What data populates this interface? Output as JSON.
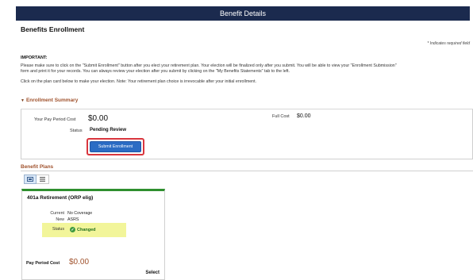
{
  "header": {
    "title": "Benefit Details"
  },
  "page": {
    "title": "Benefits Enrollment",
    "required_note": "* Indicates required field",
    "important_label": "IMPORTANT:",
    "para1_line1": "Please make sure to click on the \"Submit Enrollment\" button after you elect your retirement plan. Your election will be finalized only after you submit. You will be able to view your \"Enrollment Submission\"",
    "para1_line2": "form and print it for your records. You can always review your election after you submit by clicking on the \"My Benefits Statements\" tab to the left.",
    "para2": "Click on the plan card below to make your election. Note: Your retirement plan choice is irrevocable after your initial enrollment."
  },
  "summary": {
    "section_label": "Enrollment Summary",
    "pay_period_cost_label": "Your Pay Period Cost",
    "pay_period_cost_value": "$0.00",
    "full_cost_label": "Full Cost",
    "full_cost_value": "$0.00",
    "status_label": "Status",
    "status_value": "Pending Review",
    "submit_button": "Submit Enrollment"
  },
  "benefit_plans": {
    "section_label": "Benefit Plans",
    "view_toggle": [
      "card-view-icon",
      "list-view-icon"
    ],
    "card": {
      "title": "401a Retirement  (ORP elig)",
      "current_label": "Current",
      "current_value": "No Coverage",
      "new_label": "New",
      "new_value": "ASRS",
      "status_label": "Status",
      "status_value": "Changed",
      "pay_period_cost_label": "Pay Period Cost",
      "pay_period_cost_value": "$0.00",
      "select_label": "Select"
    }
  },
  "colors": {
    "header_bg": "#1b2a4e",
    "section_heading": "#a0522d",
    "submit_button_bg": "#2b6cc4",
    "highlight_border": "#d9363e",
    "card_top_border": "#2f8f2f",
    "status_highlight": "#f2f59a"
  }
}
